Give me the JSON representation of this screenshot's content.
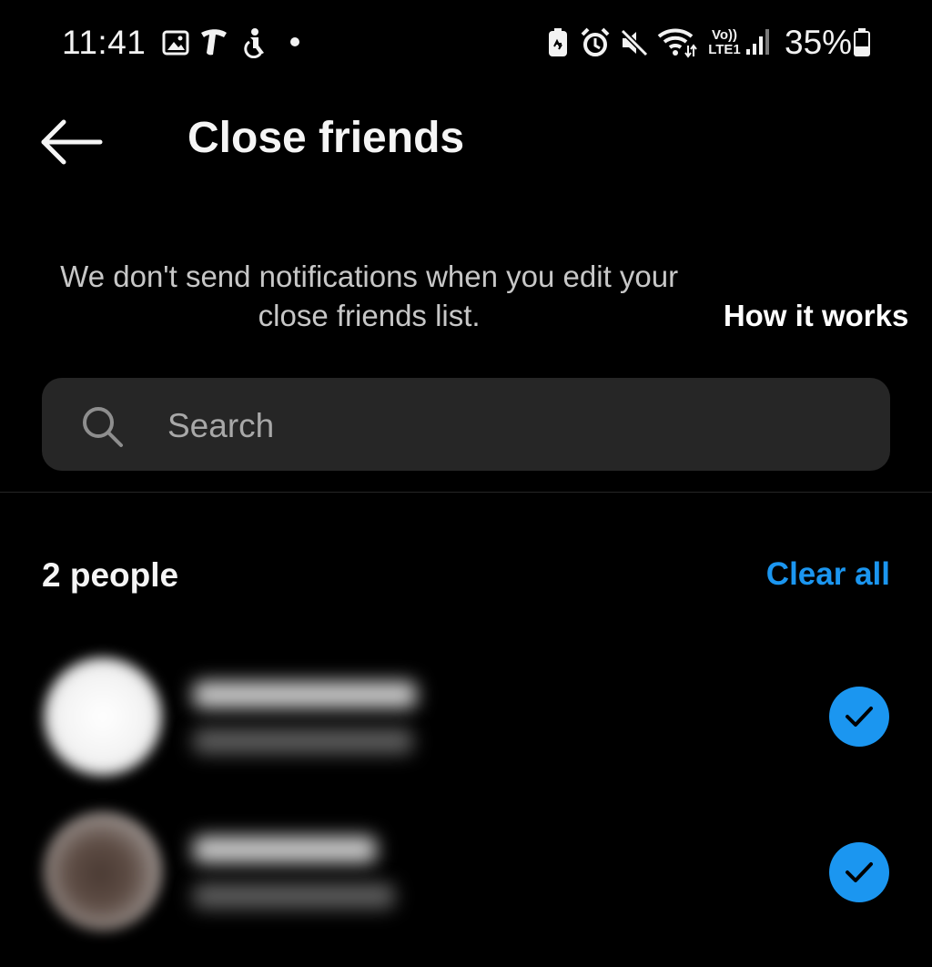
{
  "status_bar": {
    "time": "11:41",
    "icons": [
      "gallery-icon",
      "telstra-icon",
      "accessibility-icon",
      "dot-icon",
      "battery-saver-icon",
      "alarm-icon",
      "mute-icon",
      "wifi-icon",
      "volte-lte-icon",
      "signal-icon",
      "battery-icon"
    ],
    "battery_percent": "35%",
    "network_label": "LTE1",
    "volte_label": "Vo))"
  },
  "header": {
    "title": "Close friends",
    "back_icon": "arrow-left-icon"
  },
  "notice": {
    "text": "We don't send notifications when you edit your close friends list.",
    "link": "How it works"
  },
  "search": {
    "placeholder": "Search",
    "value": "",
    "icon": "search-icon"
  },
  "list": {
    "count_label": "2 people",
    "clear_label": "Clear all",
    "accent_color": "#1b96f0",
    "people": [
      {
        "selected": true
      },
      {
        "selected": true
      }
    ]
  }
}
